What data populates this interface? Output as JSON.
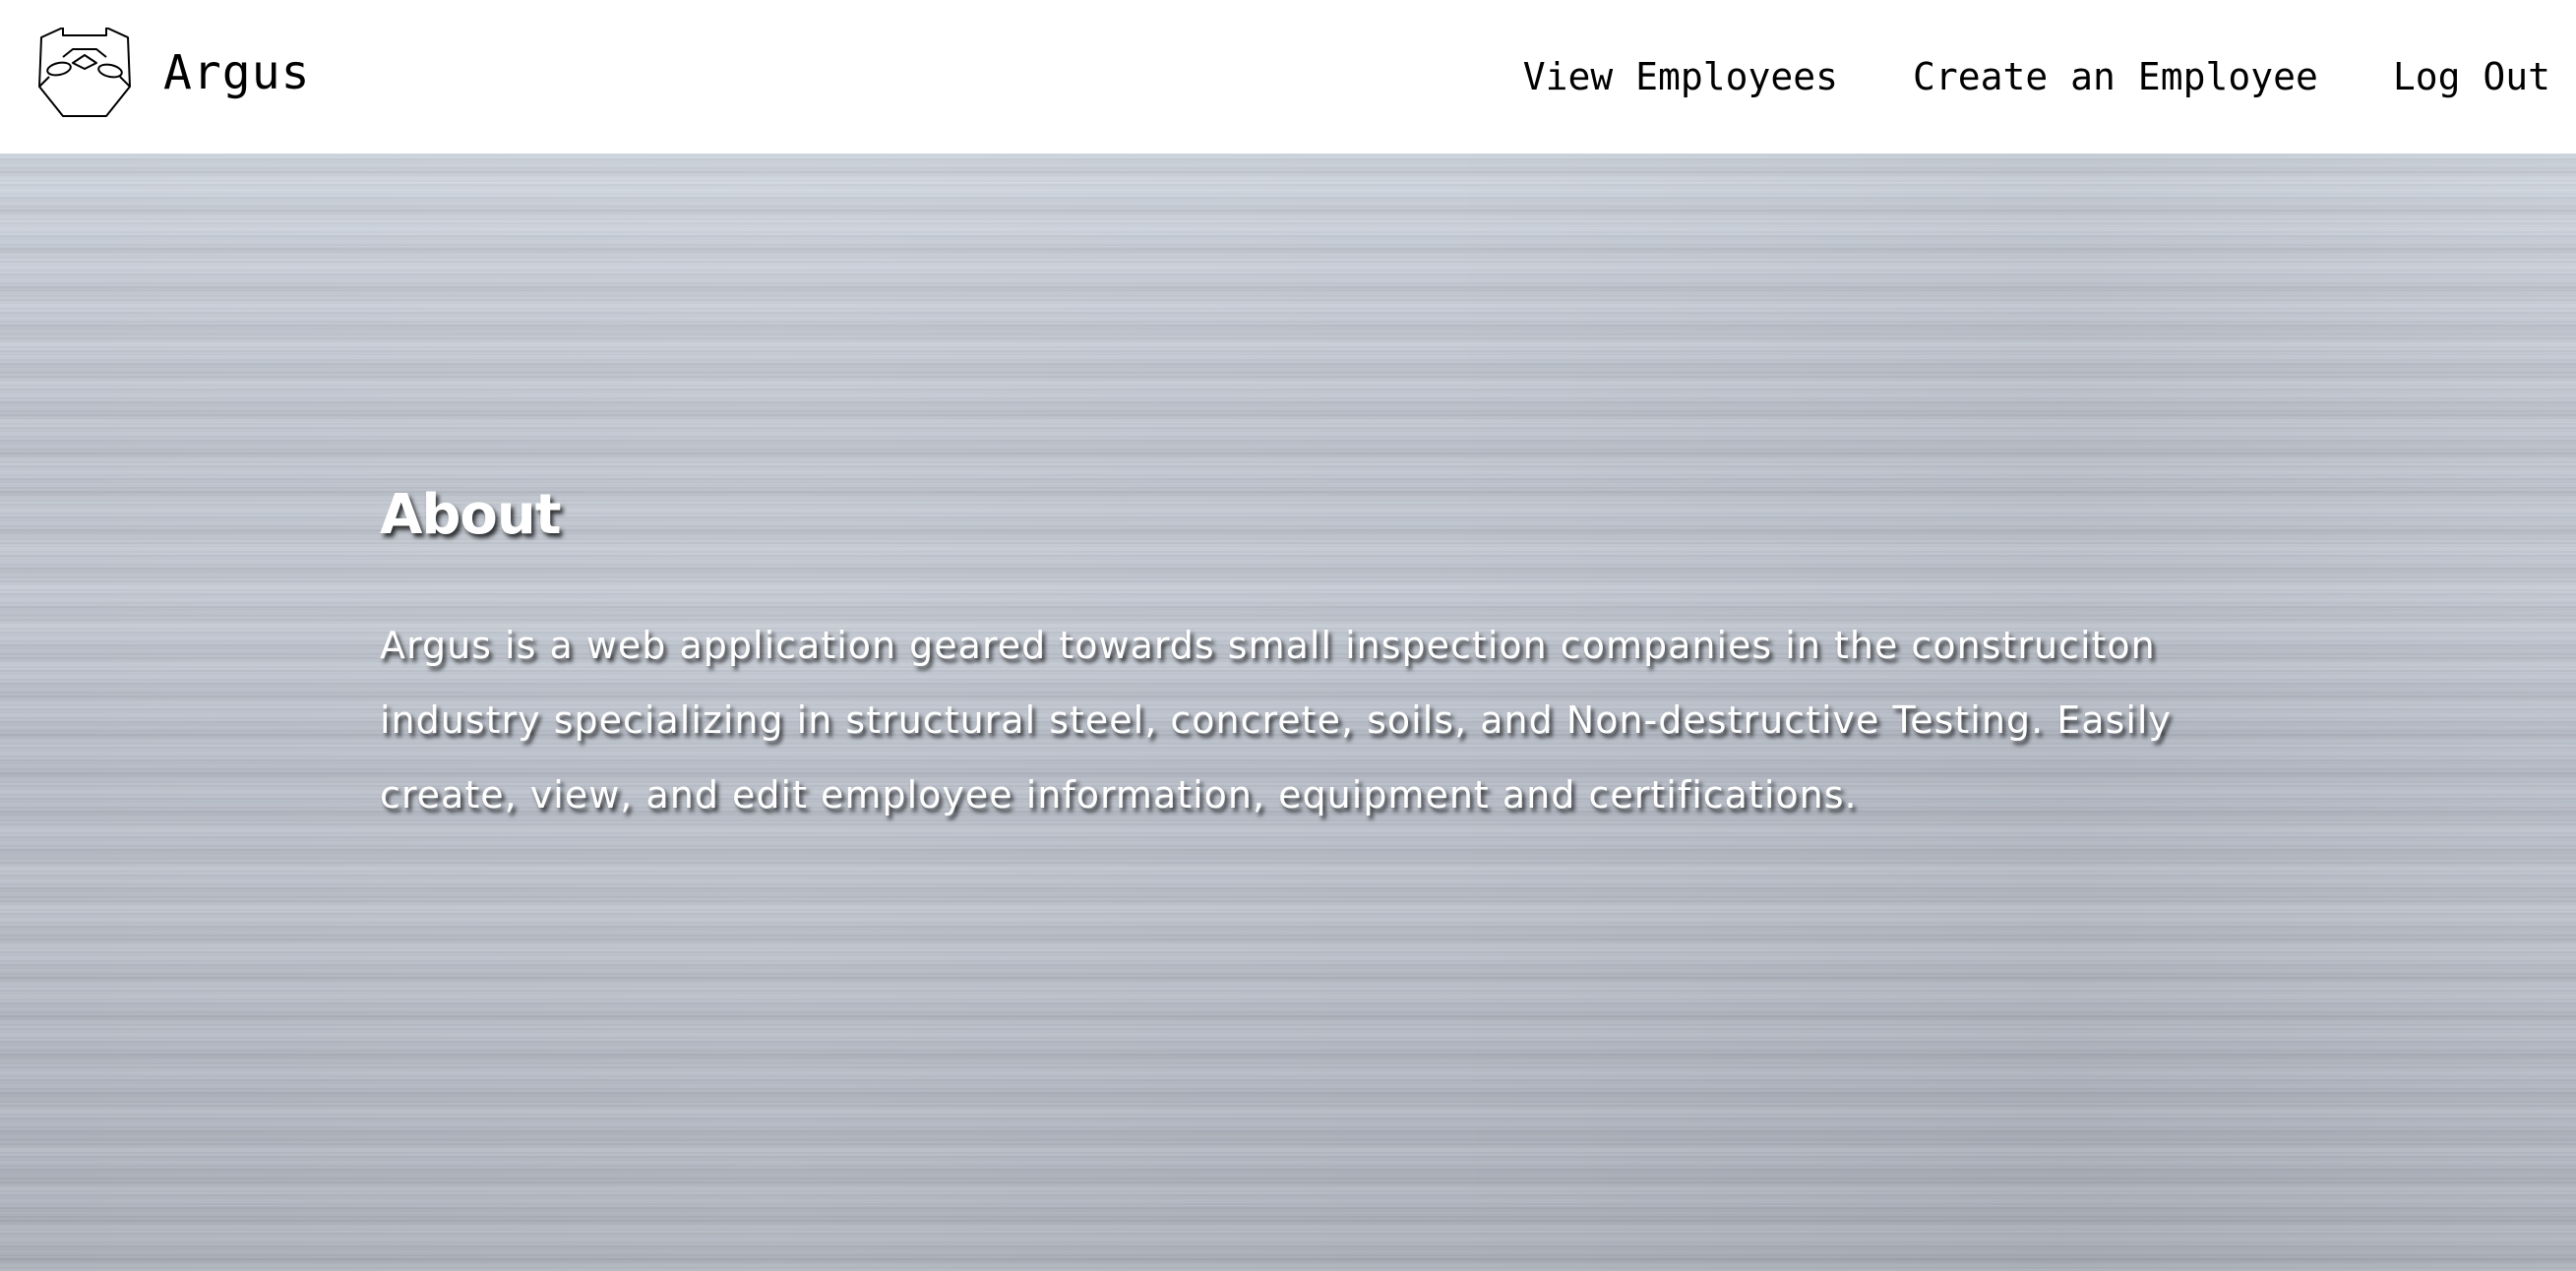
{
  "header": {
    "brand_name": "Argus",
    "logo_icon": "argus-mask-logo-icon",
    "nav": {
      "view_employees": "View Employees",
      "create_employee": "Create an Employee",
      "log_out": "Log Out"
    }
  },
  "about": {
    "title": "About",
    "text": "Argus is a web application geared towards small inspection companies in the construciton industry specializing in structural steel, concrete, soils, and Non-destructive Testing. Easily create, view, and edit employee information, equipment and certifications."
  },
  "colors": {
    "header_background": "#ffffff",
    "nav_text": "#000000",
    "hero_text": "#ffffff",
    "hero_metal": "#bfc5cf"
  }
}
